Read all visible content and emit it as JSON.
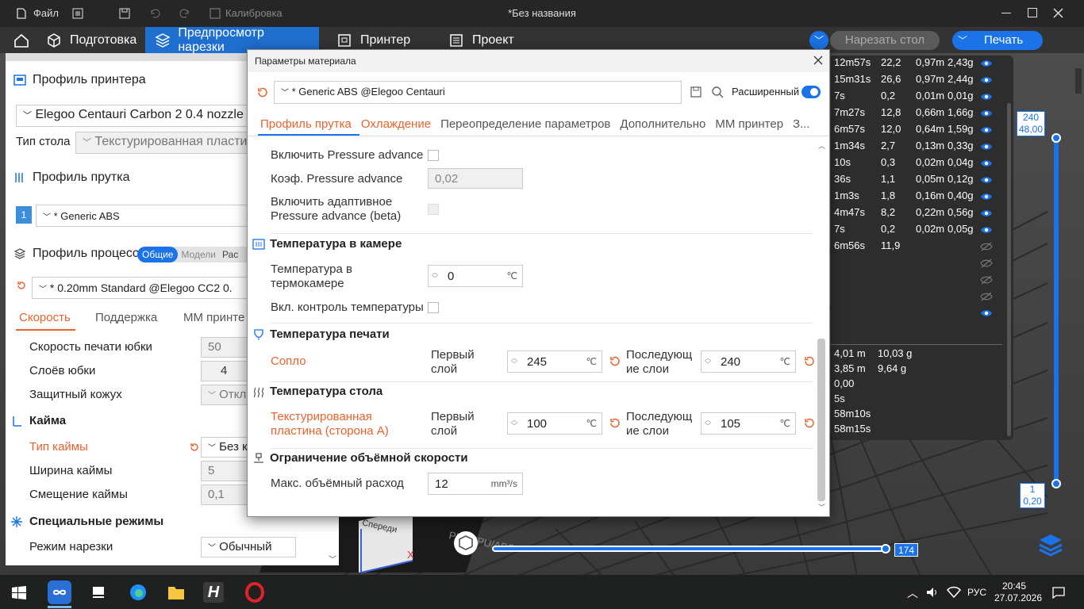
{
  "titlebar": {
    "file_menu": "Файл",
    "calibration": "Калибровка",
    "doc_title": "*Без названия"
  },
  "nav": {
    "tabs": [
      "Подготовка",
      "Предпросмотр нарезки",
      "Принтер",
      "Проект"
    ],
    "slice_label": "Нарезать стол",
    "print_label": "Печать"
  },
  "left": {
    "printer_profile": "Профиль принтера",
    "printer_name": "Elegoo Centauri Carbon 2 0.4 nozzle",
    "plate_type_label": "Тип стола",
    "plate_type_value": "Текстурированная пластин",
    "filament_profile": "Профиль прутка",
    "filament_index": "1",
    "filament_name": "* Generic ABS",
    "process_profile": "Профиль процесса",
    "process_toggle": [
      "Общие",
      "Модели",
      "Рас"
    ],
    "process_name": "* 0.20mm Standard @Elegoo CC2 0.",
    "process_tabs": [
      "Скорость",
      "Поддержка",
      "MM принте"
    ],
    "rows": [
      {
        "label": "Скорость печати юбки",
        "value": "50"
      },
      {
        "label": "Слоёв юбки",
        "value": "4"
      },
      {
        "label": "Защитный кожух",
        "value": "Откл"
      }
    ],
    "brim_section": "Кайма",
    "brim_rows": [
      {
        "label": "Тип каймы",
        "value": "Без к"
      },
      {
        "label": "Ширина каймы",
        "value": "5"
      },
      {
        "label": "Смещение каймы",
        "value": "0,1"
      }
    ],
    "special_section": "Специальные режимы",
    "slice_mode_label": "Режим нарезки",
    "slice_mode_value": "Обычный"
  },
  "dialog": {
    "title": "Параметры материала",
    "preset": "* Generic ABS @Elegoo Centauri",
    "advanced_label": "Расширенный",
    "tabs": [
      "Профиль прутка",
      "Охлаждение",
      "Переопределение параметров",
      "Дополнительно",
      "MM принтер",
      "З..."
    ],
    "pa_enable": "Включить Pressure advance",
    "pa_coef": "Коэф. Pressure advance",
    "pa_coef_value": "0,02",
    "pa_adaptive": "Включить адаптивное Pressure advance (beta)",
    "chamber_section": "Температура в камере",
    "chamber_temp_label": "Температура в термокамере",
    "chamber_temp_value": "0",
    "temp_control": "Вкл. контроль температуры",
    "print_temp_section": "Температура печати",
    "nozzle_label": "Сопло",
    "first_layer": "Первый слой",
    "next_layers": "Последующ ие слои",
    "nozzle_first": "245",
    "nozzle_next": "240",
    "bed_section": "Температура стола",
    "bed_label": "Текстурированная пластина (сторона А)",
    "bed_first": "100",
    "bed_next": "105",
    "vol_section": "Ограничение объёмной скорости",
    "vol_label": "Макс. объёмный расход",
    "vol_value": "12",
    "unit_c": "℃",
    "unit_vol": "mm³/s"
  },
  "stats": {
    "rows": [
      [
        "12m57s",
        "22,2",
        "0,97m",
        "2,43g"
      ],
      [
        "15m31s",
        "26,6",
        "0,97m",
        "2,44g"
      ],
      [
        "7s",
        "0,2",
        "0,01m",
        "0,01g"
      ],
      [
        "7m27s",
        "12,8",
        "0,66m",
        "1,66g"
      ],
      [
        "6m57s",
        "12,0",
        "0,64m",
        "1,59g"
      ],
      [
        "1m34s",
        "2,7",
        "0,13m",
        "0,33g"
      ],
      [
        "10s",
        "0,3",
        "0,02m",
        "0,04g"
      ],
      [
        "36s",
        "1,1",
        "0,05m",
        "0,12g"
      ],
      [
        "1m3s",
        "1,8",
        "0,16m",
        "0,40g"
      ],
      [
        "4m47s",
        "8,2",
        "0,22m",
        "0,56g"
      ],
      [
        "7s",
        "0,2",
        "0,02m",
        "0,05g"
      ],
      [
        "6m56s",
        "11,9",
        "",
        ""
      ]
    ],
    "summary": [
      [
        "4,01 m",
        "10,03 g"
      ],
      [
        "3,85 m",
        "9,64 g"
      ],
      [
        "0,00",
        ""
      ],
      [
        "5s",
        ""
      ],
      [
        "58m10s",
        ""
      ],
      [
        "58m15s",
        ""
      ]
    ]
  },
  "slider": {
    "top_a": "240",
    "top_b": "48,00",
    "bottom_a": "1",
    "bottom_b": "0,20",
    "horizontal": "174"
  },
  "scene": {
    "front_label": "Спереди",
    "x_axis": "X",
    "plate_text": "PLA/TPU/ABS"
  },
  "taskbar": {
    "time": "20:45",
    "date": "27.07.2026",
    "lang": "РУС"
  },
  "colors": {
    "accent": "#1a73e8",
    "orange": "#e8632b",
    "tab_active": "#1f6fd1"
  }
}
